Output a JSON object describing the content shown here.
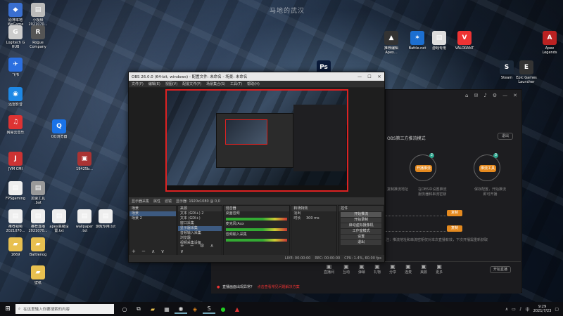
{
  "wallpaper_mark": "马地的武汉",
  "desktop_icons_left": [
    {
      "label": "原神本地\nWeGame",
      "color": "#3a6fd0",
      "glyph": "◆"
    },
    {
      "label": "小视频\n2021070...",
      "color": "#bbb",
      "glyph": "▤"
    },
    {
      "label": "Logitech G\nHUB",
      "color": "#ccc",
      "glyph": "G"
    },
    {
      "label": "Rogue\nCompany",
      "color": "#555",
      "glyph": "R"
    },
    {
      "label": "飞书",
      "color": "#2b6fe0",
      "glyph": "✈"
    },
    {
      "label": "迅雷影音",
      "color": "#1e88e5",
      "glyph": "◉"
    },
    {
      "label": "网易云音乐",
      "color": "#d33",
      "glyph": "♫"
    },
    {
      "label": "QQ浏览器",
      "color": "#1a73e8",
      "glyph": "Q"
    },
    {
      "label": "JVM CMI",
      "color": "#c33",
      "glyph": "J"
    },
    {
      "label": "19425b...",
      "color": "#a33",
      "glyph": "▣"
    },
    {
      "label": "FPSgaming",
      "color": "#eee",
      "glyph": "▤"
    },
    {
      "label": "加速工具\n.bat",
      "color": "#999",
      "glyph": "▤"
    },
    {
      "label": "推荐视频\n2021070...",
      "color": "#eee",
      "glyph": "▤"
    },
    {
      "label": "推荐直播\n2021070...",
      "color": "#eee",
      "glyph": "▤"
    },
    {
      "label": "apex高级设\n置.txt",
      "color": "#eee",
      "glyph": "▤"
    },
    {
      "label": "wallpaper\n.txt",
      "color": "#eee",
      "glyph": "▤"
    },
    {
      "label": "游戏专用.txt",
      "color": "#eee",
      "glyph": "▤"
    },
    {
      "label": "1669",
      "color": "#e8c050",
      "glyph": "▰"
    },
    {
      "label": "Battlenog",
      "color": "#e8c050",
      "glyph": "▰"
    },
    {
      "label": "壁纸",
      "color": "#e8c050",
      "glyph": "▰"
    }
  ],
  "desktop_icons_right": [
    {
      "label": "推荐编辑\nApex...",
      "color": "#333",
      "glyph": "▲"
    },
    {
      "label": "Battle.net",
      "color": "#1c6fd1",
      "glyph": "✶"
    },
    {
      "label": "游戏专用",
      "color": "#ddd",
      "glyph": "▤"
    },
    {
      "label": "VALORANT",
      "color": "#e33",
      "glyph": "V"
    },
    {
      "label": "Epic Games\nLauncher",
      "color": "#333",
      "glyph": "E"
    },
    {
      "label": "Steam",
      "color": "#1b2838",
      "glyph": "S"
    },
    {
      "label": "Apex\nLegends",
      "color": "#b22",
      "glyph": "A"
    },
    {
      "label": "Photoshop",
      "color": "#0a1a3a",
      "glyph": "Ps"
    }
  ],
  "obs": {
    "title": "OBS 26.0.0 (64-bit, windows) - 配置文件: 未命名 - 场景: 未命名",
    "menu": [
      "文件(F)",
      "编辑(E)",
      "视图(V)",
      "配置文件(P)",
      "场景集合(S)",
      "工具(T)",
      "帮助(H)"
    ],
    "scene_bar": [
      "显示器采集",
      "属性",
      "滤镜",
      "显示器: 1920x1080 @ 0,0"
    ],
    "docks": {
      "scenes": {
        "title": "场景",
        "items": [
          "场景",
          "场景 2"
        ]
      },
      "sources": {
        "title": "来源",
        "items": [
          "文本 (GDI+) 2",
          "文本 (GDI+)",
          "窗口采集",
          "显示器采集",
          "音频输入采集",
          "浏览器",
          "视频采集设备"
        ]
      },
      "mixer": {
        "title": "混音器",
        "items": [
          "桌面音频",
          "麦克风/Aux",
          "音频输入采集"
        ]
      },
      "transitions": {
        "title": "转场特效",
        "fade": "淡出",
        "duration_label": "时长",
        "duration": "300 ms"
      },
      "controls": {
        "title": "控件",
        "buttons": [
          "开始推流",
          "开始录制",
          "启动虚拟摄像机",
          "工作室模式",
          "设置",
          "退出"
        ]
      }
    },
    "status": [
      "LIVE: 00:00:00",
      "REC: 00:00:00",
      "CPU: 1.4%, 60.00 fps"
    ]
  },
  "right_app": {
    "title": "OBS第三方推流模式",
    "top_button": "退出",
    "step2": "开播推流",
    "step3": "推流工具",
    "step1_text": "复制推流地址",
    "step2_text": "在OBS中设置推流\n服务器和串流密钥",
    "step3_text": "保存配置，开始推流\n即可开播",
    "copy_label": "复制",
    "note": "注：推流地址和串流密钥仅对本次直播有效，下次开播需重新获取"
  },
  "bottom_app": {
    "icons": [
      "直播间",
      "互动",
      "弹幕",
      "礼物",
      "分享",
      "连麦",
      "美颜",
      "更多"
    ],
    "live_button": "开始直播",
    "warning": "直播画面出现异常？",
    "warning_link": "点击查看常见问题解决方案"
  },
  "taskbar": {
    "search_placeholder": "在这里输入你要搜索的内容",
    "clock_time": "9:29",
    "clock_date": "2021/7/23"
  }
}
